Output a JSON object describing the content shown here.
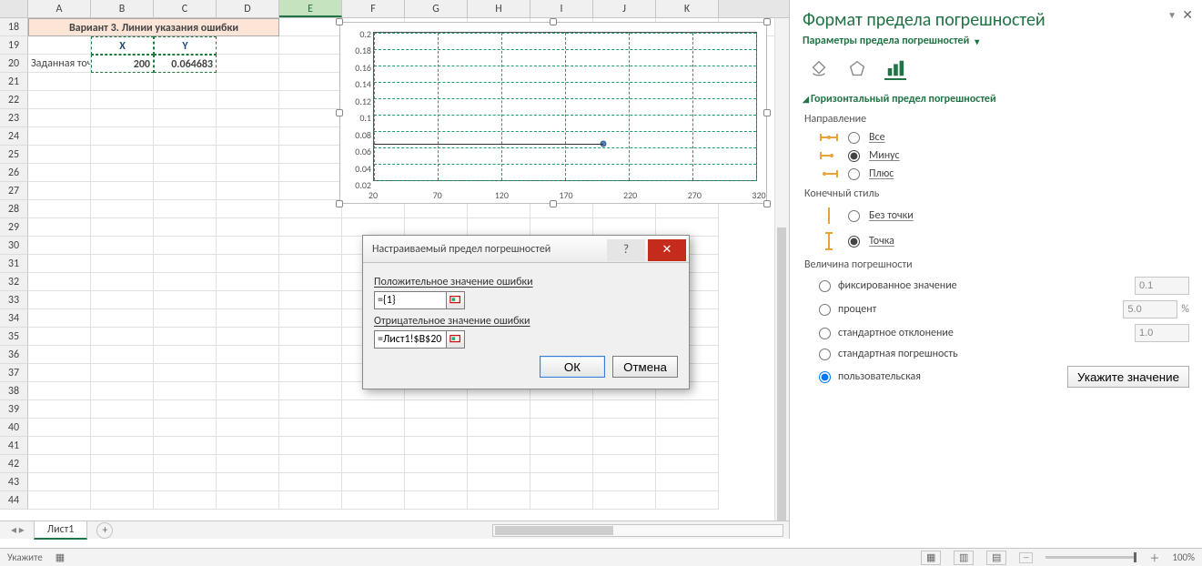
{
  "columns": [
    "A",
    "B",
    "C",
    "D",
    "E",
    "F",
    "G",
    "H",
    "I",
    "J",
    "K"
  ],
  "selected_col": "E",
  "row_start": 18,
  "row_end": 44,
  "cells": {
    "r18_merged": "Вариант 3. Линии указания ошибки",
    "r19_X": "X",
    "r19_Y": "Y",
    "r20_label": "Заданная точка -",
    "r20_X": "200",
    "r20_Y": "0.064683"
  },
  "chart_data": {
    "type": "scatter",
    "x": [
      200
    ],
    "y": [
      0.064683
    ],
    "xlim": [
      20,
      320
    ],
    "ylim": [
      0.02,
      0.2
    ],
    "xticks": [
      20,
      70,
      120,
      170,
      220,
      270,
      320
    ],
    "yticks": [
      0.02,
      0.04,
      0.06,
      0.08,
      0.1,
      0.12,
      0.14,
      0.16,
      0.18,
      0.2
    ]
  },
  "dialog": {
    "title": "Настраиваемый предел погрешностей",
    "pos_label": "Положительное значение ошибки",
    "pos_value": "={1}",
    "neg_label": "Отрицательное значение ошибки",
    "neg_value": "=Лист1!$B$20",
    "ok": "ОК",
    "cancel": "Отмена"
  },
  "tabs": {
    "sheet1": "Лист1"
  },
  "pane": {
    "title": "Формат предела погрешностей",
    "subtitle": "Параметры предела погрешностей",
    "section": "Горизонтальный предел погрешностей",
    "direction_label": "Направление",
    "dir_all": "Все",
    "dir_minus": "Минус",
    "dir_plus": "Плюс",
    "endstyle_label": "Конечный стиль",
    "end_none": "Без точки",
    "end_cap": "Точка",
    "amount_label": "Величина погрешности",
    "amt_fixed": "фиксированное значение",
    "amt_fixed_val": "0.1",
    "amt_percent": "процент",
    "amt_percent_val": "5.0",
    "amt_stddev": "стандартное отклонение",
    "amt_stddev_val": "1.0",
    "amt_stderr": "стандартная погрешность",
    "amt_custom": "пользовательская",
    "specify_btn": "Укажите значение"
  },
  "status": {
    "mode": "Укажите",
    "zoom": "100%"
  }
}
